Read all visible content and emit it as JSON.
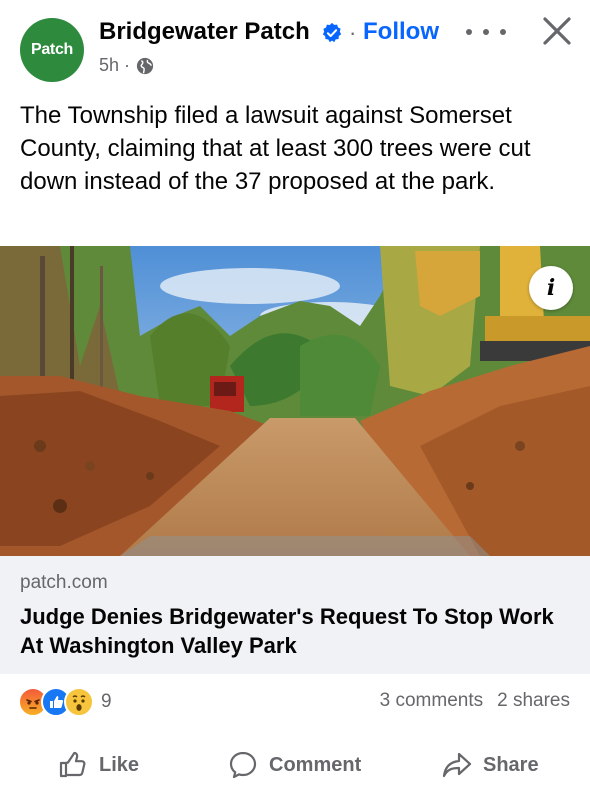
{
  "header": {
    "avatar_text": "Patch",
    "page_name": "Bridgewater Patch",
    "separator": "·",
    "follow_label": "Follow",
    "time": "5h ·",
    "icons": [
      "verified-badge-icon",
      "globe-icon",
      "more-icon",
      "close-icon"
    ]
  },
  "post": {
    "text": "The Township filed a lawsuit against Somerset County, claiming that at least 300 trees were cut down instead of the 37 proposed at the park."
  },
  "image": {
    "info_label": "i"
  },
  "link": {
    "domain": "patch.com",
    "title": "Judge Denies Bridgewater's Request To Stop Work At Washington Valley Park"
  },
  "engagement": {
    "reaction_icons": [
      "angry-icon",
      "like-icon",
      "wow-icon"
    ],
    "reaction_count": "9",
    "comments": "3 comments",
    "shares": "2 shares"
  },
  "actions": {
    "like_label": "Like",
    "comment_label": "Comment",
    "share_label": "Share"
  },
  "colors": {
    "accent": "#0866ff",
    "avatar_bg": "#2e8b3e",
    "muted_text": "#65676b",
    "card_bg": "#f0f2f5"
  }
}
